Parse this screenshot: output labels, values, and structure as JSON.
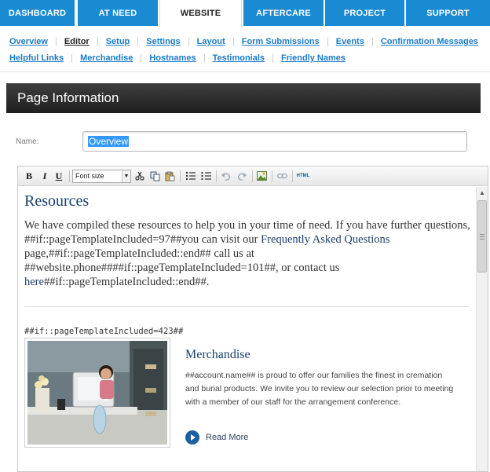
{
  "top_tabs": [
    {
      "label": "DASHBOARD"
    },
    {
      "label": "AT NEED"
    },
    {
      "label": "WEBSITE"
    },
    {
      "label": "AFTERCARE"
    },
    {
      "label": "PROJECT"
    },
    {
      "label": "SUPPORT"
    }
  ],
  "sub_nav": {
    "row1": [
      "Overview",
      "Editor",
      "Setup",
      "Settings",
      "Layout",
      "Form Submissions",
      "Events",
      "Confirmation Messages"
    ],
    "row2": [
      "Helpful Links",
      "Merchandise",
      "Hostnames",
      "Testimonials",
      "Friendly Names"
    ]
  },
  "page_header": {
    "title": "Page Information"
  },
  "name_field": {
    "label": "Name:",
    "value": "Overview"
  },
  "toolbar": {
    "bold": "B",
    "italic": "I",
    "underline": "U",
    "font_size": "Font size",
    "html": "HTML"
  },
  "content": {
    "resources_title": "Resources",
    "resources_text_1": "We have compiled these resources to help you in your time of need. If you have further questions, ##if::pageTemplateIncluded=97##you can visit our ",
    "resources_link_1": "Frequently Asked Questions",
    "resources_text_2": " page,##if::pageTemplateIncluded::end## call us at ##website.phone####if::pageTemplateIncluded=101##, or contact us ",
    "resources_link_2": "here",
    "resources_text_3": "##if::pageTemplateIncluded::end##.",
    "template_tag": "##if::pageTemplateIncluded=423##",
    "merch_title": "Merchandise",
    "merch_text": "##account.name## is proud to offer our families the finest in cremation and burial products. We invite you to review our selection prior to meeting with a member of our staff for the arrangement conference.",
    "read_more": "Read More"
  },
  "colors": {
    "tab_blue": "#1a8ad2",
    "link_blue": "#1a7bc9",
    "header_dark": "#2c2c2c",
    "content_title": "#1a3e6e"
  }
}
